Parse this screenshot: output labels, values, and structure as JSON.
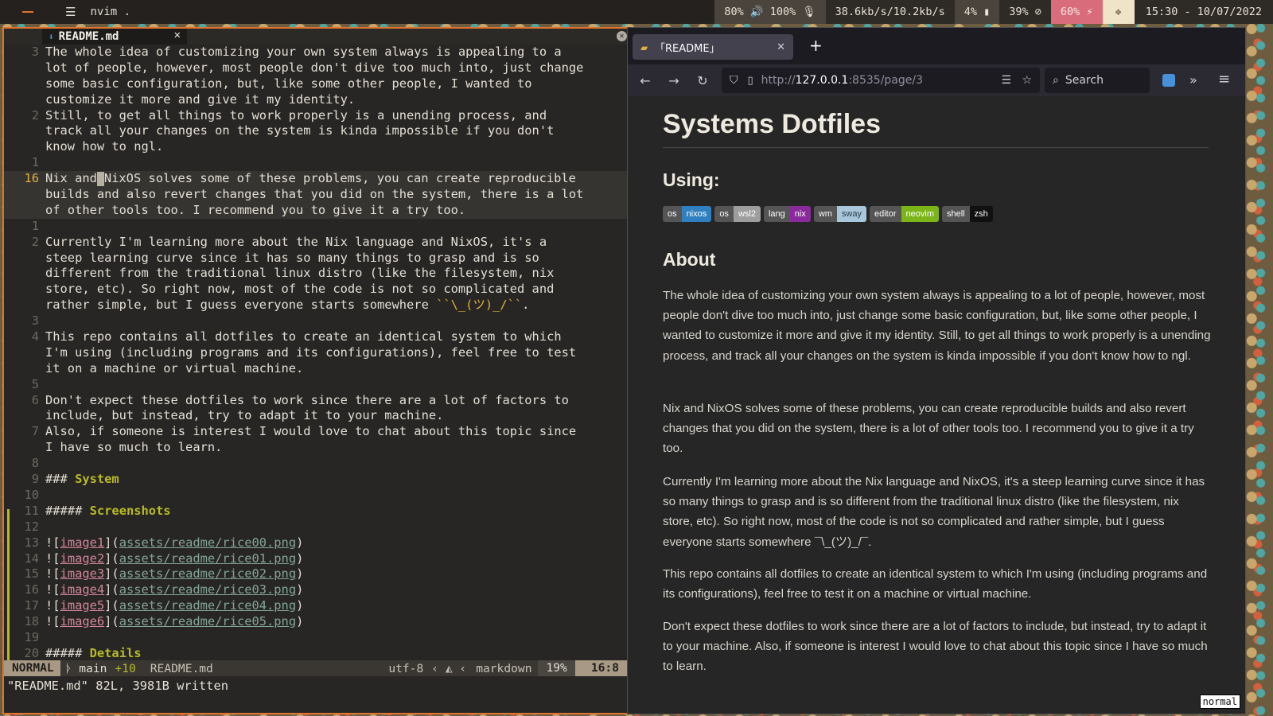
{
  "topbar": {
    "window_title": "nvim .",
    "menu_icon": "menu-icon",
    "modules": {
      "audio": "80% 🔊 100% 🎙",
      "network": "38.6kb/s/10.2kb/s",
      "cpu": "4% ▮",
      "memory": "39% ⊘",
      "battery": "60% ⚡",
      "dropbox_icon": "dropbox-icon",
      "clock": "15:30 - 10/07/2022"
    }
  },
  "editor": {
    "tab_label": "README.md",
    "tab_close": "✕",
    "lines": [
      {
        "num": "3",
        "text": "The whole idea of customizing your own system always is appealing to a"
      },
      {
        "num": "",
        "text": "lot of people, however, most people don't dive too much into, just change"
      },
      {
        "num": "",
        "text": "some basic configuration, but, like some other people, I wanted to"
      },
      {
        "num": "",
        "text": "customize it more and give it my identity."
      },
      {
        "num": "2",
        "text": "Still, to get all things to work properly is a unending process, and"
      },
      {
        "num": "",
        "text": "track all your changes on the system is kinda impossible if you don't"
      },
      {
        "num": "",
        "text": "know how to ngl."
      },
      {
        "num": "1",
        "text": ""
      },
      {
        "num": "16",
        "text_before": "Nix and",
        "text_after": "NixOS solves some of these problems, you can create reproducible",
        "current": true
      },
      {
        "num": "",
        "text": "builds and also revert changes that you did on the system, there is a lot",
        "current": true
      },
      {
        "num": "",
        "text": "of other tools too. I recommend you to give it a try too.",
        "current": true
      },
      {
        "num": "1",
        "text": ""
      },
      {
        "num": "2",
        "text": "Currently I'm learning more about the Nix language and NixOS, it's a"
      },
      {
        "num": "",
        "text": "steep learning curve since it has so many things to grasp and is so"
      },
      {
        "num": "",
        "text": "different from the traditional linux distro (like the filesystem, nix"
      },
      {
        "num": "",
        "text": "store, etc). So right now, most of the code is not so complicated and"
      },
      {
        "num": "",
        "text": "rather simple, but I guess everyone starts somewhere ",
        "tail": "``\\_(ツ)_/``",
        "end": "."
      },
      {
        "num": "3",
        "text": ""
      },
      {
        "num": "4",
        "text": "This repo contains all dotfiles to create an identical system to which"
      },
      {
        "num": "",
        "text": "I'm using (including programs and its configurations), feel free to test"
      },
      {
        "num": "",
        "text": "it on a machine or virtual machine."
      },
      {
        "num": "5",
        "text": ""
      },
      {
        "num": "6",
        "text": "Don't expect these dotfiles to work since there are a lot of factors to"
      },
      {
        "num": "",
        "text": "include, but instead, try to adapt it to your machine."
      },
      {
        "num": "7",
        "text": "Also, if someone is interest I would love to chat about this topic since"
      },
      {
        "num": "",
        "text": "I have so much to learn."
      },
      {
        "num": "8",
        "text": ""
      },
      {
        "num": "9",
        "hashes": "###",
        "heading": "System"
      },
      {
        "num": "10",
        "text": ""
      },
      {
        "num": "11",
        "hashes": "#####",
        "heading": "Screenshots"
      },
      {
        "num": "12",
        "text": ""
      },
      {
        "num": "13",
        "link": "image1",
        "url": "assets/readme/rice00.png"
      },
      {
        "num": "14",
        "link": "image2",
        "url": "assets/readme/rice01.png"
      },
      {
        "num": "15",
        "link": "image3",
        "url": "assets/readme/rice02.png"
      },
      {
        "num": "16",
        "link": "image4",
        "url": "assets/readme/rice03.png"
      },
      {
        "num": "17",
        "link": "image5",
        "url": "assets/readme/rice04.png"
      },
      {
        "num": "18",
        "link": "image6",
        "url": "assets/readme/rice05.png"
      },
      {
        "num": "19",
        "text": ""
      },
      {
        "num": "20",
        "hashes": "#####",
        "heading": "Details"
      }
    ],
    "statusline": {
      "mode": "NORMAL",
      "branch": "ᚦ main",
      "added": "+10",
      "file": "README.md",
      "encoding": "utf-8",
      "filetype": "markdown",
      "percent": "19%",
      "position": "16:8"
    },
    "cmdline": "\"README.md\" 82L, 3981B written"
  },
  "browser": {
    "tab_title": "「README」",
    "tab_close": "✕",
    "new_tab": "+",
    "url_host_prefix": "http://",
    "url_host": "127.0.0.1",
    "url_rest": ":8535/page/3",
    "search_placeholder": "Search",
    "page": {
      "title": "Systems Dotfiles",
      "using_heading": "Using:",
      "badges": [
        {
          "key": "os",
          "value": "nixos",
          "color": "#2f7fc1"
        },
        {
          "key": "os",
          "value": "wsl2",
          "color": "#9e9e9e"
        },
        {
          "key": "lang",
          "value": "nix",
          "color": "#8a2a9c"
        },
        {
          "key": "wm",
          "value": "sway",
          "color": "#a9c7db"
        },
        {
          "key": "editor",
          "value": "neovim",
          "color": "#7cb518"
        },
        {
          "key": "shell",
          "value": "zsh",
          "color": "#111111"
        }
      ],
      "about_heading": "About",
      "paragraphs": [
        "The whole idea of customizing your own system always is appealing to a lot of people, however, most people don't dive too much into, just change some basic configuration, but, like some other people, I wanted to customize it more and give it my identity. Still, to get all things to work properly is a unending process, and track all your changes on the system is kinda impossible if you don't know how to ngl.",
        "Nix and NixOS solves some of these problems, you can create reproducible builds and also revert changes that you did on the system, there is a lot of other tools too. I recommend you to give it a try too.",
        "Currently I'm learning more about the Nix language and NixOS, it's a steep learning curve since it has so many things to grasp and is so different from the traditional linux distro (like the filesystem, nix store, etc). So right now, most of the code is not so complicated and rather simple, but I guess everyone starts somewhere ¯\\_(ツ)_/¯.",
        "This repo contains all dotfiles to create an identical system to which I'm using (including programs and its configurations), feel free to test it on a machine or virtual machine.",
        "Don't expect these dotfiles to work since there are a lot of factors to include, but instead, try to adapt it to your machine. Also, if someone is interest I would love to chat about this topic since I have so much to learn."
      ]
    },
    "mode_tag": "normal"
  }
}
